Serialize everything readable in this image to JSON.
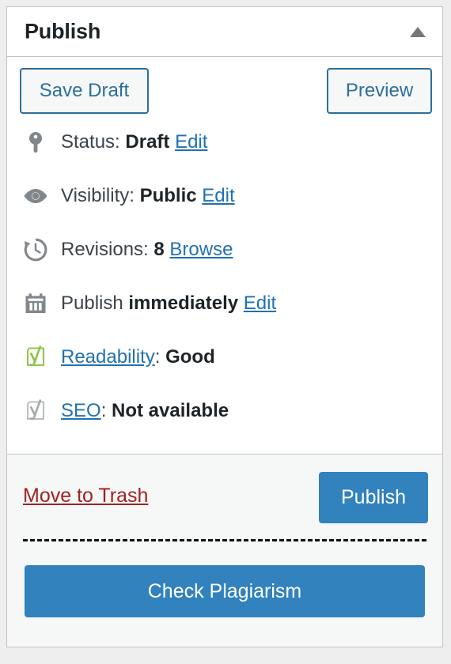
{
  "panel": {
    "title": "Publish",
    "toggle_icon": "caret-up-icon",
    "toggle_label": "Toggle panel: Publish"
  },
  "minor_actions": {
    "save_draft_label": "Save Draft",
    "preview_label": "Preview"
  },
  "misc_actions": [
    {
      "icon": "post-status-pin-icon",
      "label": "Status:",
      "value": "Draft",
      "link": "Edit",
      "link_style": "underline"
    },
    {
      "icon": "visibility-eye-icon",
      "label": "Visibility:",
      "value": "Public",
      "link": "Edit",
      "link_style": "underline"
    },
    {
      "icon": "revisions-clock-icon",
      "label": "Revisions:",
      "value": "8",
      "link": "Browse",
      "link_style": "underline"
    },
    {
      "icon": "calendar-icon",
      "label": "Publish",
      "value": "immediately",
      "link": "Edit",
      "link_style": "underline"
    },
    {
      "icon": "yoast-readability-icon",
      "label_link": "Readability",
      "separator": ":",
      "value": "Good"
    },
    {
      "icon": "yoast-seo-icon",
      "label_link": "SEO",
      "separator": ":",
      "value": "Not available"
    }
  ],
  "major_actions": {
    "trash_label": "Move to Trash",
    "publish_label": "Publish",
    "check_plagiarism_label": "Check Plagiarism"
  },
  "colors": {
    "link_blue": "#2271b1",
    "button_blue": "#3182bd",
    "secondary_border_blue": "#2c6f9b",
    "trash_red": "#a02222",
    "yoast_green": "#77b227",
    "yoast_gray": "#a7aaad",
    "icon_gray": "#82878c",
    "panel_border": "#c3c4c7",
    "footer_bg": "#f6f7f7",
    "page_bg": "#eeeeee"
  }
}
